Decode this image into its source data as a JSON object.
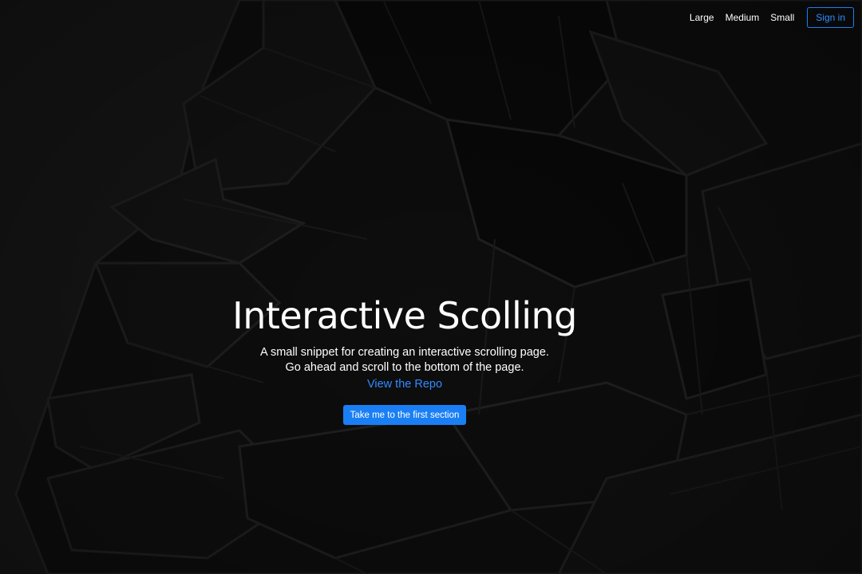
{
  "nav": {
    "links": [
      {
        "label": "Large"
      },
      {
        "label": "Medium"
      },
      {
        "label": "Small"
      }
    ],
    "signin_label": "Sign in",
    "accent_color": "#1a7ff5"
  },
  "hero": {
    "title": "Interactive Scolling",
    "description_line1": "A small snippet for creating an interactive scrolling page.",
    "description_line2": "Go ahead and scroll to the bottom of the page.",
    "repo_link": "View the Repo",
    "cta_label": "Take me to the first section",
    "background": "dark monochrome photo of a brutalist building"
  }
}
